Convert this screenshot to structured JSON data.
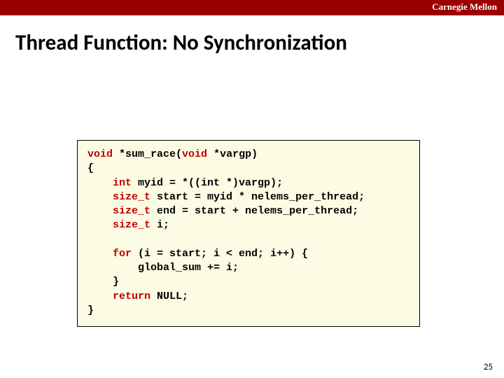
{
  "brand": "Carnegie Mellon",
  "title": "Thread Function: No Synchronization",
  "code": {
    "kw_void1": "void",
    "funcdecl_mid": " *sum_race(",
    "kw_void2": "void",
    "funcdecl_end": " *vargp)",
    "lbrace": "{",
    "indent": "    ",
    "kw_int": "int",
    "line_myid": " myid = *((int *)vargp);",
    "kw_sizet1": "size_t",
    "line_start": " start = myid * nelems_per_thread;",
    "kw_sizet2": "size_t",
    "line_end": " end = start + nelems_per_thread;",
    "kw_sizet3": "size_t",
    "line_i": " i;",
    "blank": "",
    "kw_for": "for",
    "line_for": " (i = start; i < end; i++) {",
    "indent2": "        ",
    "line_sum": "global_sum += i;",
    "line_closefor": "}",
    "kw_return": "return",
    "line_return": " NULL;",
    "rbrace": "}"
  },
  "page_number": "25"
}
